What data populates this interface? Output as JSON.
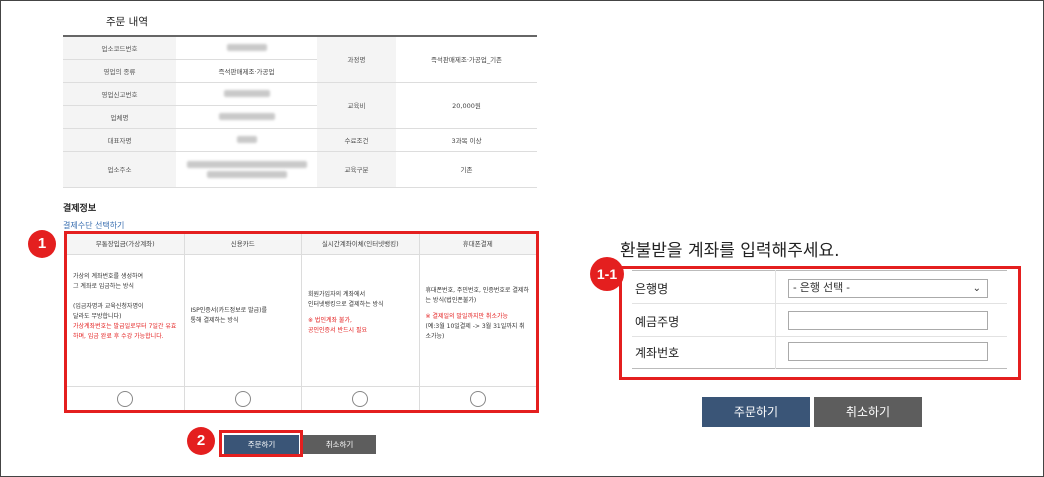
{
  "order": {
    "title": "주문 내역",
    "rows": {
      "biz_code_label": "업소코드번호",
      "biz_type_label": "영업의 종류",
      "biz_type_value": "즉석판매제조·가공업",
      "license_label": "영업신고번호",
      "company_label": "업체명",
      "rep_label": "대표자명",
      "address_label": "업소주소",
      "course_label": "과정명",
      "course_value": "즉석판매제조·가공업_기존",
      "fee_label": "교육비",
      "fee_value": "20,000원",
      "complete_label": "수료조건",
      "complete_value": "3과목 이상",
      "edu_type_label": "교육구분",
      "edu_type_value": "기존"
    }
  },
  "payment": {
    "title": "결제정보",
    "select_label": "결제수단 선택하기",
    "methods": [
      {
        "head": "무통장입금(가상계좌)",
        "line1": "가상의 계좌번호를 생성하여",
        "line2": "그 계좌로 입금하는 방식",
        "line3": "(입금자명과 교육신청자명이",
        "line4": "달라도 무방합니다)",
        "red": "가상계좌번호는 발급일로부터 7일간 유효하며, 입금 완료 후 수강 가능합니다."
      },
      {
        "head": "신용카드",
        "line1": "ISP인증서(카드정보로 발급)를",
        "line2": "통해 결제하는 방식"
      },
      {
        "head": "실시간계좌이체(인터넷뱅킹)",
        "line1": "회원가입자의 계좌에서",
        "line2": "인터넷뱅킹으로 결제하는 방식",
        "red1": "※ 법인계좌 불가,",
        "red2": "공인인증서 반드시 필요"
      },
      {
        "head": "휴대폰결제",
        "line1": "휴대폰번호, 주민번호, 인증번호로 결제하는 방식(법인폰불가)",
        "red": "※ 결제일의 말일까지만 취소가능",
        "line2": "(예:3월 10일결제 -> 3월 31일까지 취소가능)"
      }
    ],
    "order_button": "주문하기",
    "cancel_button": "취소하기"
  },
  "badges": {
    "one": "1",
    "two": "2",
    "one_one": "1-1"
  },
  "refund": {
    "title": "환불받을 계좌를 입력해주세요.",
    "bank_label": "은행명",
    "bank_select": "- 은행 선택 -",
    "holder_label": "예금주명",
    "account_label": "계좌번호",
    "order_button": "주문하기",
    "cancel_button": "취소하기"
  },
  "colors": {
    "highlight": "#e41f1f",
    "primary_button": "#3a5577",
    "secondary_button": "#5d5d5d"
  }
}
